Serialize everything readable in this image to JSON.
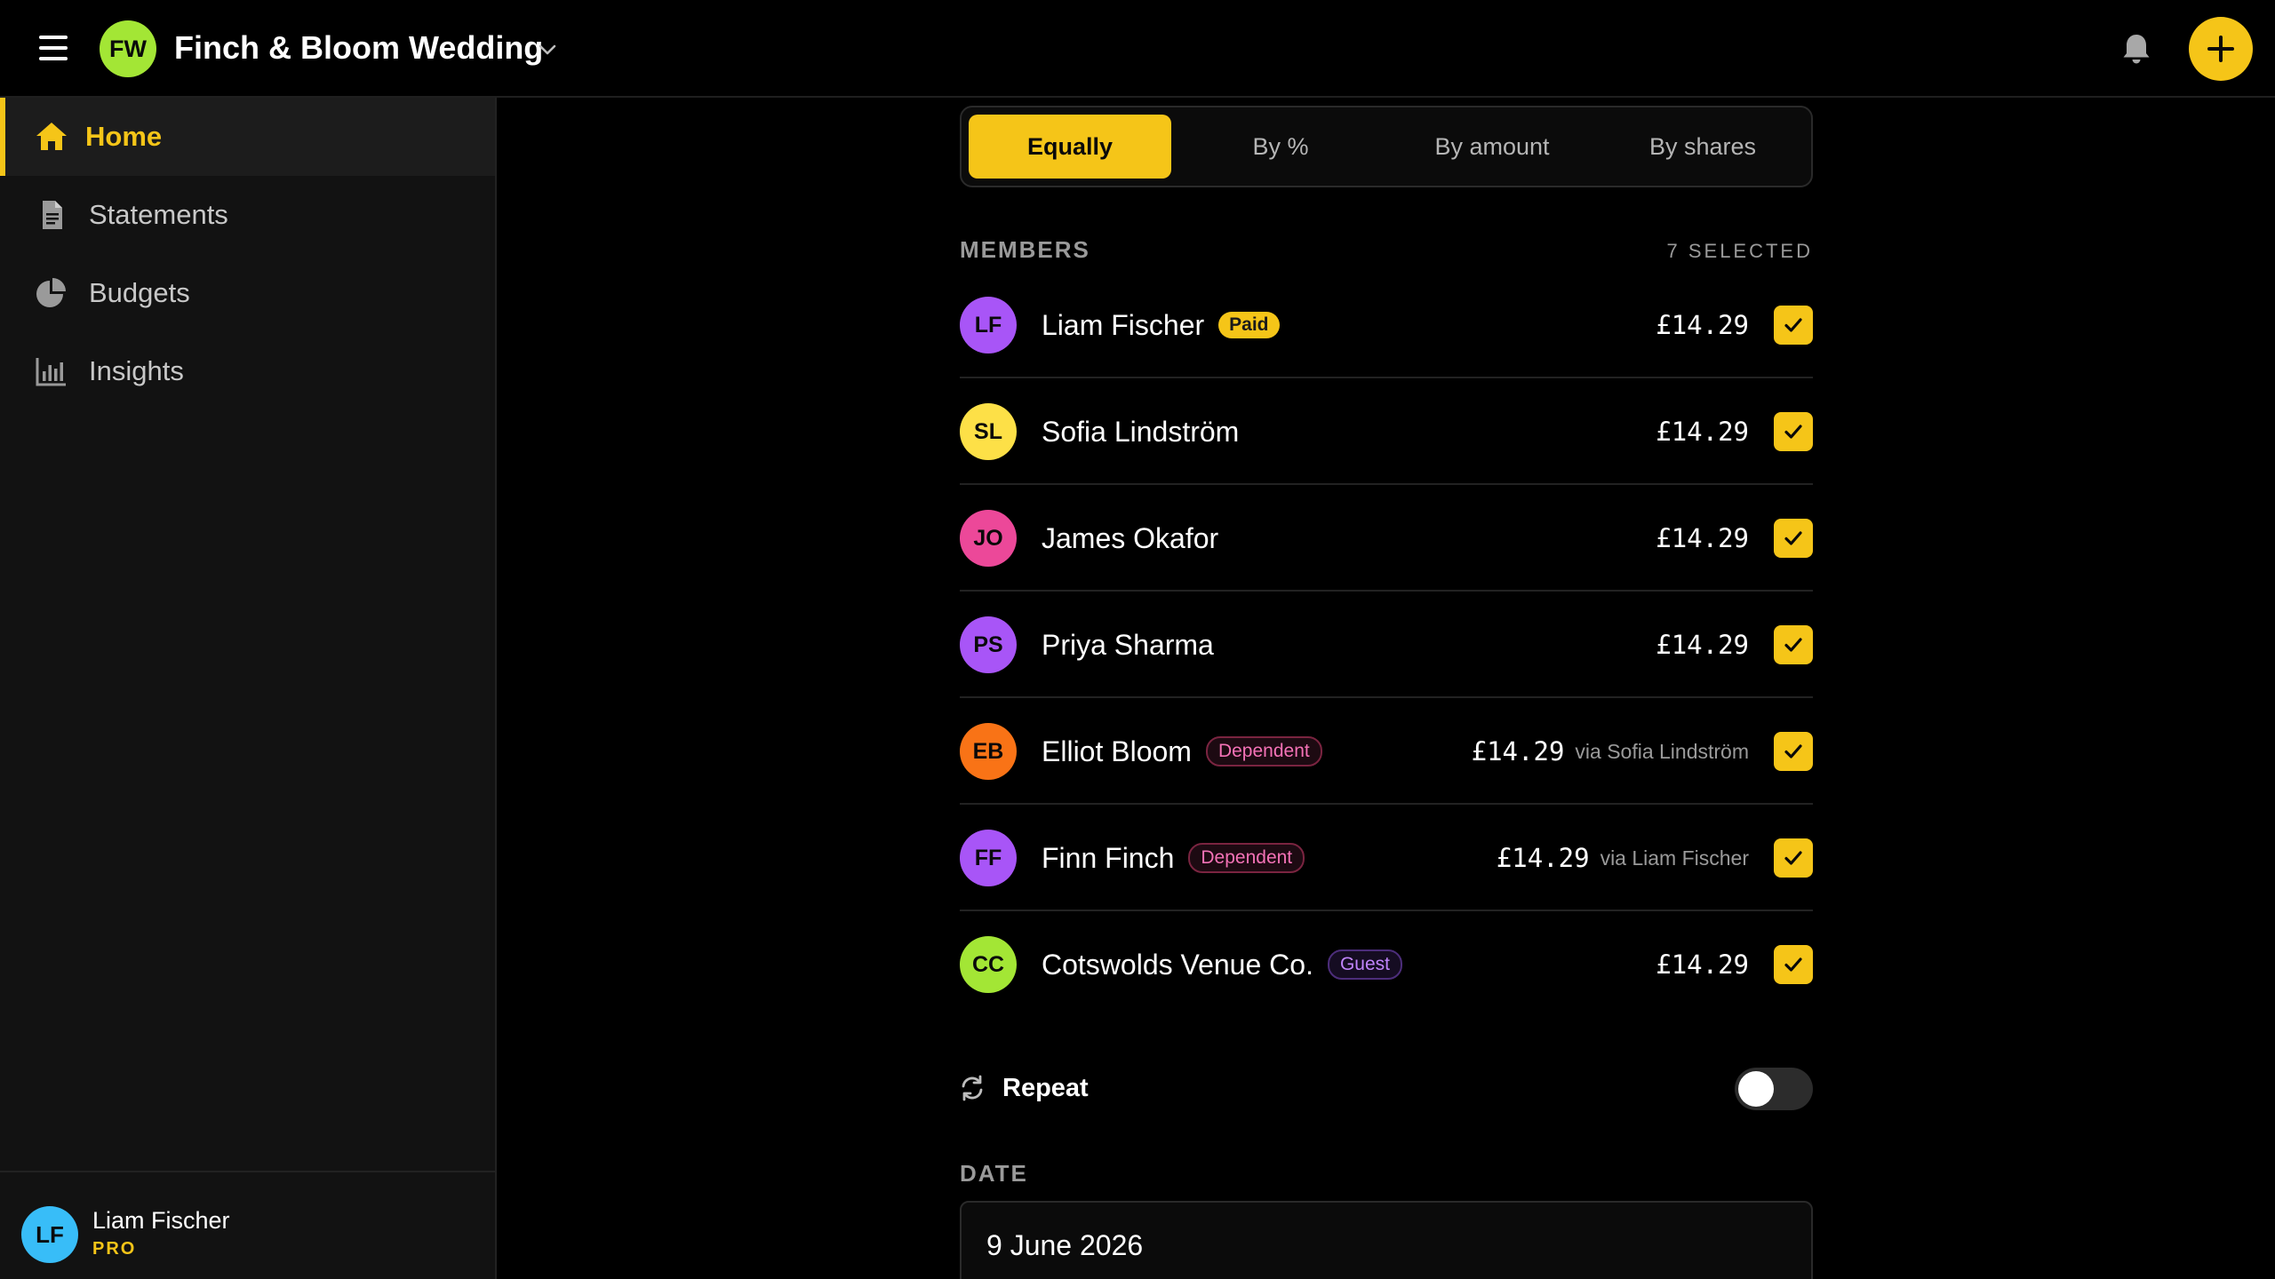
{
  "topbar": {
    "workspace_initials": "FW",
    "workspace_name": "Finch & Bloom Wedding",
    "icons": [
      "menu-icon",
      "chevron-down-icon",
      "bell-icon",
      "plus-icon"
    ]
  },
  "sidebar": {
    "items": [
      {
        "label": "Home",
        "icon": "home-icon",
        "active": true
      },
      {
        "label": "Statements",
        "icon": "document-icon",
        "active": false
      },
      {
        "label": "Budgets",
        "icon": "pie-chart-icon",
        "active": false
      },
      {
        "label": "Insights",
        "icon": "bar-chart-icon",
        "active": false
      }
    ],
    "user": {
      "initials": "LF",
      "name": "Liam Fischer",
      "plan": "PRO"
    }
  },
  "split": {
    "options": [
      "Equally",
      "By %",
      "By amount",
      "By shares"
    ],
    "selected": "Equally"
  },
  "members": {
    "heading": "MEMBERS",
    "selected_count": "7 SELECTED",
    "list": [
      {
        "initials": "LF",
        "name": "Liam Fischer",
        "badge": "Paid",
        "amount": "£14.29",
        "via": "",
        "checked": true,
        "color": "#a855f7"
      },
      {
        "initials": "SL",
        "name": "Sofia Lindström",
        "badge": "",
        "amount": "£14.29",
        "via": "",
        "checked": true,
        "color": "#fde047"
      },
      {
        "initials": "JO",
        "name": "James Okafor",
        "badge": "",
        "amount": "£14.29",
        "via": "",
        "checked": true,
        "color": "#ec4899"
      },
      {
        "initials": "PS",
        "name": "Priya Sharma",
        "badge": "",
        "amount": "£14.29",
        "via": "",
        "checked": true,
        "color": "#a855f7"
      },
      {
        "initials": "EB",
        "name": "Elliot Bloom",
        "badge": "Dependent",
        "amount": "£14.29",
        "via": "via Sofia Lindström",
        "checked": true,
        "color": "#f97316"
      },
      {
        "initials": "FF",
        "name": "Finn Finch",
        "badge": "Dependent",
        "amount": "£14.29",
        "via": "via Liam Fischer",
        "checked": true,
        "color": "#a855f7"
      },
      {
        "initials": "CC",
        "name": "Cotswolds Venue Co.",
        "badge": "Guest",
        "amount": "£14.29",
        "via": "",
        "checked": true,
        "color": "#a3e635"
      }
    ]
  },
  "repeat": {
    "label": "Repeat",
    "enabled": false
  },
  "date": {
    "heading": "DATE",
    "value": "9 June 2026"
  },
  "colors": {
    "accent": "#f5c518",
    "background": "#000000",
    "sidebar": "#121212"
  }
}
